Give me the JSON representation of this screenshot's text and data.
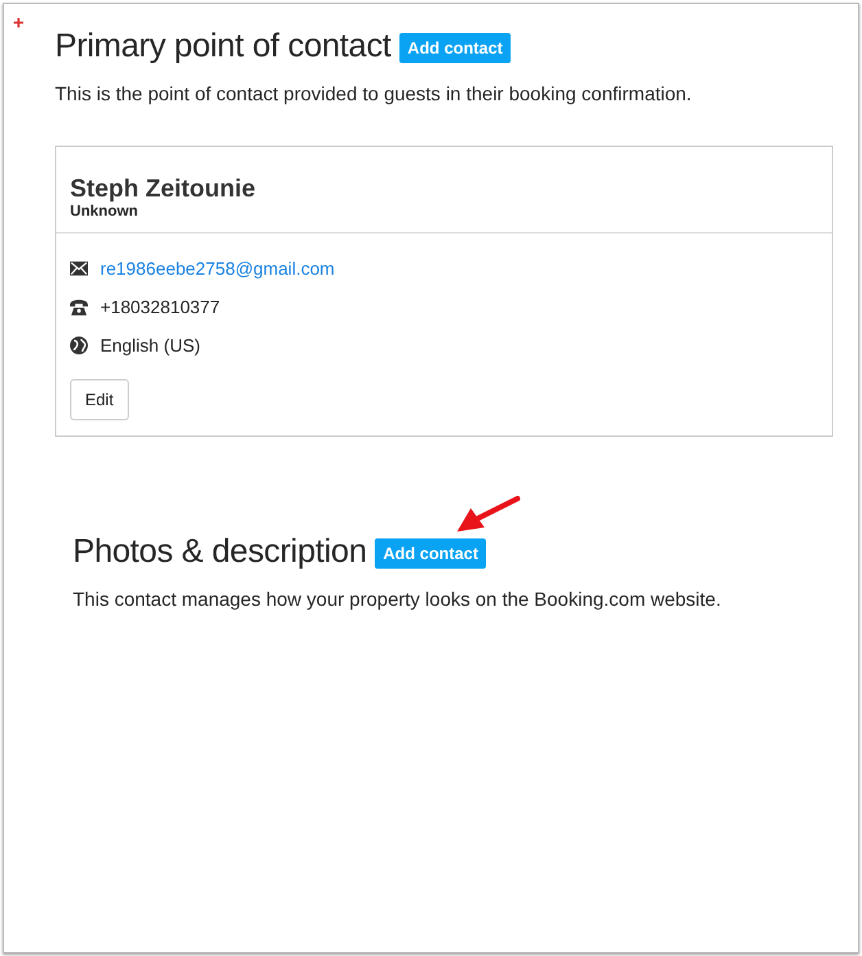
{
  "sections": [
    {
      "title": "Primary point of contact",
      "button": "Add contact",
      "description": "This is the point of contact provided to guests in their booking confirmation.",
      "card": {
        "name": "Steph Zeitounie",
        "role": "Unknown",
        "details": [
          {
            "kind": "email",
            "text": "re1986eebe2758@gmail.com"
          },
          {
            "kind": "phone",
            "text": "+18032810377"
          },
          {
            "kind": "language",
            "text": "English (US)"
          }
        ],
        "edit_button": "Edit"
      }
    },
    {
      "title": "Photos & description",
      "button": "Add contact",
      "description": "This contact manages how your property looks on the Booking.com website."
    }
  ]
}
